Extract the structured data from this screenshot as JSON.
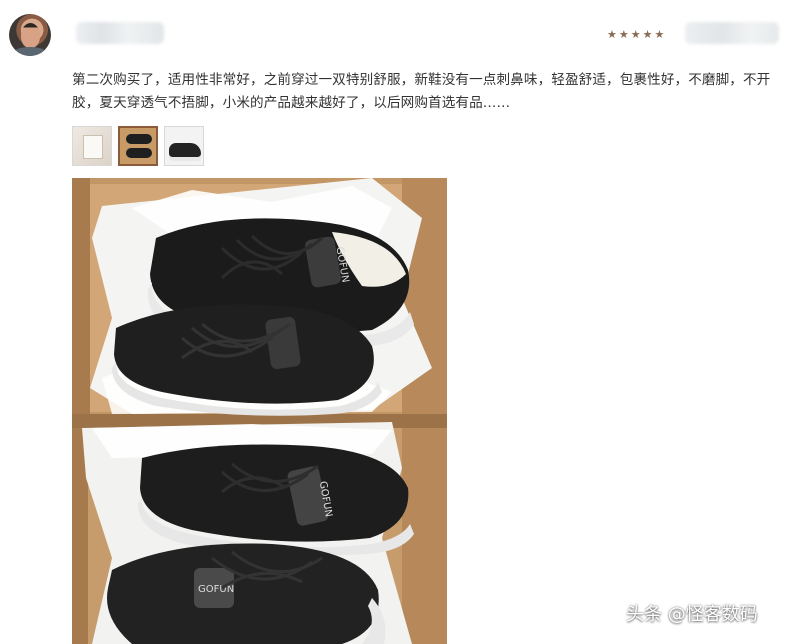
{
  "review": {
    "avatar_icon": "user-avatar",
    "rating_stars": 5,
    "star_color": "#8a6a52",
    "text": "第二次购买了，适用性非常好，之前穿过一双特别舒服，新鞋没有一点刺鼻味，轻盈舒适，包裹性好，不磨脚，不开胶，夏天穿透气不捂脚，小米的产品越来越好了，以后网购首选有品……",
    "thumbnails": [
      {
        "name": "thumbnail-box-label"
      },
      {
        "name": "thumbnail-shoes-in-box",
        "selected": true
      },
      {
        "name": "thumbnail-shoe-side"
      }
    ]
  },
  "photo": {
    "shoe_brand_label": "GOFUN",
    "accent_box_color": "#c49866"
  },
  "watermark": {
    "text": "头条 @怪客数码"
  }
}
